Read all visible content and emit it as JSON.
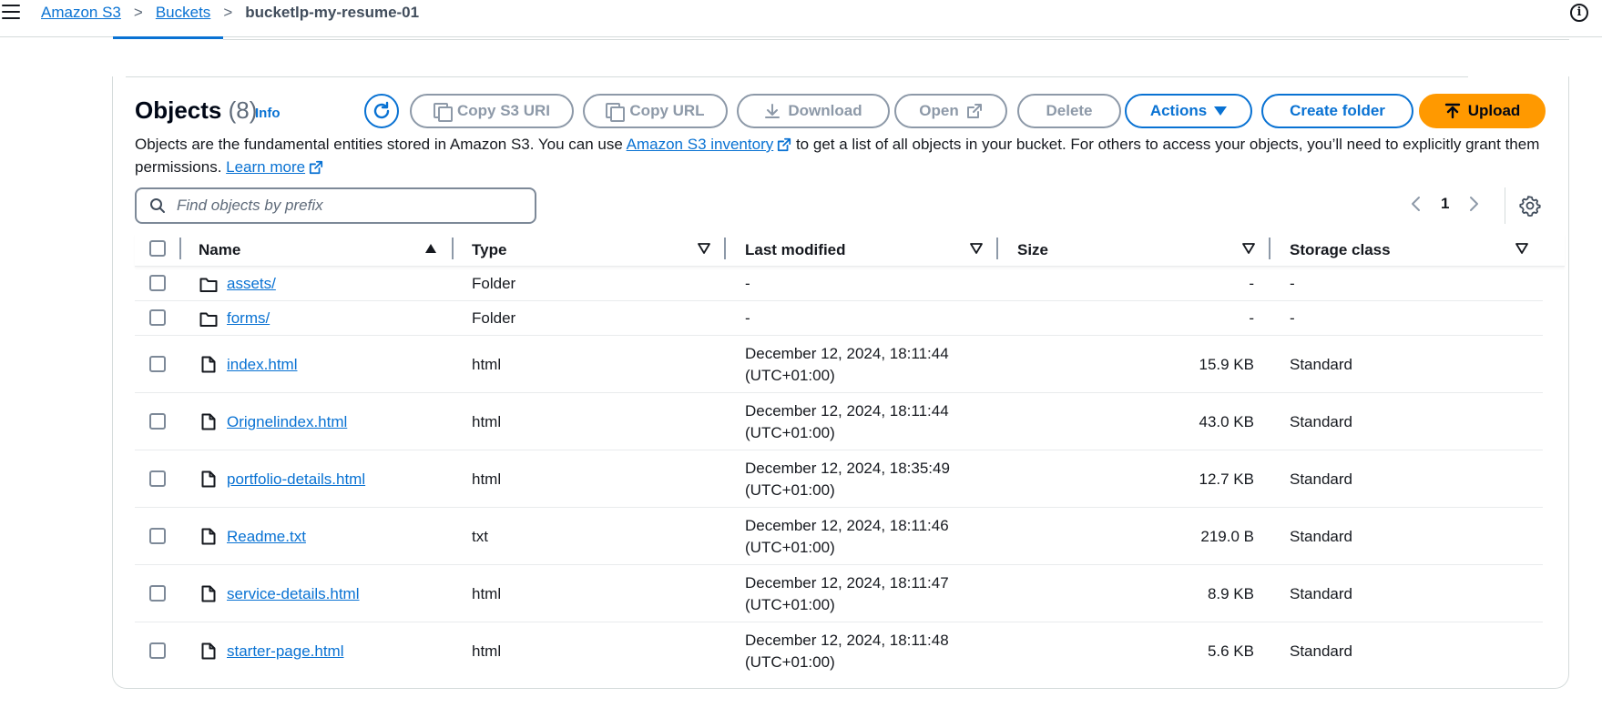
{
  "breadcrumb": {
    "items": [
      "Amazon S3",
      "Buckets"
    ],
    "current": "bucketlp-my-resume-01"
  },
  "objects": {
    "title": "Objects",
    "count": "(8)",
    "info": "Info",
    "buttons": {
      "copy_s3_uri": "Copy S3 URI",
      "copy_url": "Copy URL",
      "download": "Download",
      "open": "Open",
      "delete": "Delete",
      "actions": "Actions",
      "create_folder": "Create folder",
      "upload": "Upload"
    },
    "description": {
      "part1": "Objects are the fundamental entities stored in Amazon S3. You can use ",
      "link1": "Amazon S3 inventory",
      "part2": " to get a list of all objects in your bucket. For others to access your objects, you’ll need to explicitly grant them permissions. ",
      "link2": "Learn more"
    },
    "search_placeholder": "Find objects by prefix",
    "page": "1"
  },
  "table": {
    "columns": [
      "Name",
      "Type",
      "Last modified",
      "Size",
      "Storage class"
    ],
    "rows": [
      {
        "name": "assets/",
        "type": "Folder",
        "modified": "-",
        "modified2": "",
        "size": "-",
        "storage": "-",
        "kind": "folder"
      },
      {
        "name": "forms/",
        "type": "Folder",
        "modified": "-",
        "modified2": "",
        "size": "-",
        "storage": "-",
        "kind": "folder"
      },
      {
        "name": "index.html",
        "type": "html",
        "modified": "December 12, 2024, 18:11:44",
        "modified2": "(UTC+01:00)",
        "size": "15.9 KB",
        "storage": "Standard",
        "kind": "file"
      },
      {
        "name": "Orignelindex.html",
        "type": "html",
        "modified": "December 12, 2024, 18:11:44",
        "modified2": "(UTC+01:00)",
        "size": "43.0 KB",
        "storage": "Standard",
        "kind": "file"
      },
      {
        "name": "portfolio-details.html",
        "type": "html",
        "modified": "December 12, 2024, 18:35:49",
        "modified2": "(UTC+01:00)",
        "size": "12.7 KB",
        "storage": "Standard",
        "kind": "file"
      },
      {
        "name": "Readme.txt",
        "type": "txt",
        "modified": "December 12, 2024, 18:11:46",
        "modified2": "(UTC+01:00)",
        "size": "219.0 B",
        "storage": "Standard",
        "kind": "file"
      },
      {
        "name": "service-details.html",
        "type": "html",
        "modified": "December 12, 2024, 18:11:47",
        "modified2": "(UTC+01:00)",
        "size": "8.9 KB",
        "storage": "Standard",
        "kind": "file"
      },
      {
        "name": "starter-page.html",
        "type": "html",
        "modified": "December 12, 2024, 18:11:48",
        "modified2": "(UTC+01:00)",
        "size": "5.6 KB",
        "storage": "Standard",
        "kind": "file"
      }
    ]
  },
  "colors": {
    "link": "#0972d3",
    "upload": "#ff9900",
    "disabled": "#8d99a8"
  },
  "icons": [
    "menu-icon",
    "info-icon",
    "refresh-icon",
    "copy-icon",
    "download-icon",
    "external-link-icon",
    "caret-down-icon",
    "upload-icon",
    "search-icon",
    "chevron-left-icon",
    "chevron-right-icon",
    "gear-icon",
    "folder-icon",
    "file-icon",
    "sort-ascending-icon",
    "sort-icon"
  ]
}
